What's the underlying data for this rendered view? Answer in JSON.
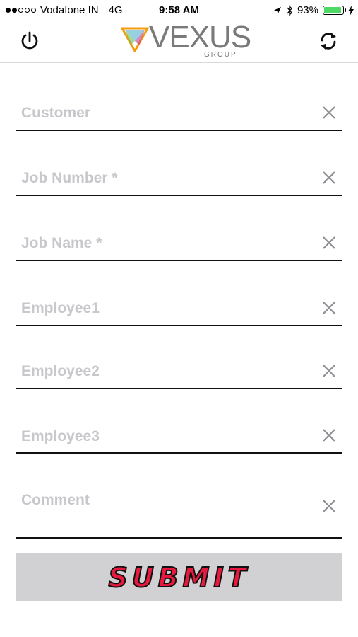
{
  "status_bar": {
    "carrier": "Vodafone IN",
    "network": "4G",
    "time": "9:58 AM",
    "battery_percent": "93%",
    "battery_level": 0.93,
    "signal_bars_filled": 2,
    "signal_bars_total": 5
  },
  "header": {
    "logo_text": "VEXUS",
    "logo_sub": "GROUP"
  },
  "form": {
    "fields": [
      {
        "placeholder": "Customer"
      },
      {
        "placeholder": "Job Number *"
      },
      {
        "placeholder": "Job Name *"
      },
      {
        "placeholder": "Employee1"
      },
      {
        "placeholder": "Employee2"
      },
      {
        "placeholder": "Employee3"
      },
      {
        "placeholder": "Comment"
      }
    ],
    "submit_label": "SUBMIT"
  },
  "colors": {
    "placeholder": "#c7c7cc",
    "submit_bg": "#d1d1d4",
    "submit_text": "#e8193f",
    "battery": "#4cd964"
  }
}
